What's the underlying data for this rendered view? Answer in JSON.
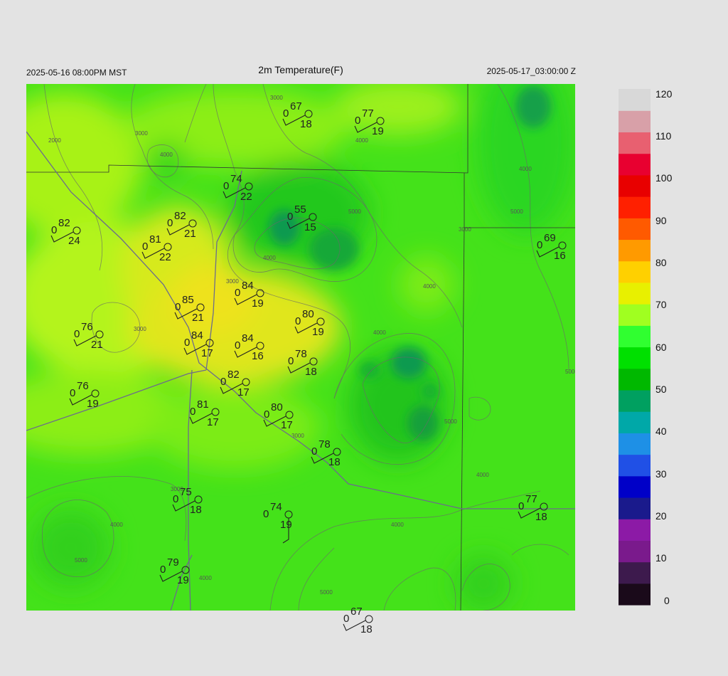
{
  "header": {
    "local_time": "2025-05-16 08:00PM MST",
    "title": "2m Temperature(F)",
    "utc_time": "2025-05-17_03:00:00 Z"
  },
  "colorbar": {
    "labels": [
      "120",
      "110",
      "100",
      "90",
      "80",
      "70",
      "60",
      "50",
      "40",
      "30",
      "20",
      "10",
      "0"
    ],
    "colors": [
      "#1a0a1a",
      "#3d1a4d",
      "#7a1a8c",
      "#8c1aa6",
      "#1a1a8c",
      "#0000c8",
      "#2050e6",
      "#1e90e6",
      "#00a8a8",
      "#00a060",
      "#00b800",
      "#00e000",
      "#30ff30",
      "#a0ff20",
      "#e8f000",
      "#ffd000",
      "#ff9a00",
      "#ff5a00",
      "#ff2000",
      "#e80000",
      "#e80030",
      "#e86070",
      "#d8a0a8",
      "#d8d8d8"
    ]
  },
  "stations": [
    {
      "temp": "67",
      "dew": "18",
      "cloud": "0"
    },
    {
      "temp": "77",
      "dew": "19",
      "cloud": "0"
    },
    {
      "temp": "74",
      "dew": "22",
      "cloud": "0"
    },
    {
      "temp": "55",
      "dew": "15",
      "cloud": "0"
    },
    {
      "temp": "82",
      "dew": "24",
      "cloud": "0"
    },
    {
      "temp": "82",
      "dew": "21",
      "cloud": "0"
    },
    {
      "temp": "81",
      "dew": "22",
      "cloud": "0"
    },
    {
      "temp": "69",
      "dew": "16",
      "cloud": "0"
    },
    {
      "temp": "85",
      "dew": "21",
      "cloud": "0"
    },
    {
      "temp": "84",
      "dew": "19",
      "cloud": "0"
    },
    {
      "temp": "80",
      "dew": "19",
      "cloud": "0"
    },
    {
      "temp": "76",
      "dew": "21",
      "cloud": "0"
    },
    {
      "temp": "84",
      "dew": "17",
      "cloud": "0"
    },
    {
      "temp": "84",
      "dew": "16",
      "cloud": "0"
    },
    {
      "temp": "78",
      "dew": "18",
      "cloud": "0"
    },
    {
      "temp": "82",
      "dew": "17",
      "cloud": "0"
    },
    {
      "temp": "76",
      "dew": "19",
      "cloud": "0"
    },
    {
      "temp": "81",
      "dew": "17",
      "cloud": "0"
    },
    {
      "temp": "80",
      "dew": "17",
      "cloud": "0"
    },
    {
      "temp": "78",
      "dew": "18",
      "cloud": "0"
    },
    {
      "temp": "75",
      "dew": "18",
      "cloud": "0"
    },
    {
      "temp": "74",
      "dew": "19",
      "cloud": "0"
    },
    {
      "temp": "77",
      "dew": "18",
      "cloud": "0"
    },
    {
      "temp": "79",
      "dew": "19",
      "cloud": "0"
    },
    {
      "temp": "67",
      "dew": "18",
      "cloud": "0"
    }
  ],
  "contour_labels": [
    "2000",
    "3000",
    "4000",
    "3000",
    "4000",
    "5000",
    "3000",
    "4000",
    "4000",
    "5000",
    "4000",
    "3000",
    "3000",
    "4000",
    "5000",
    "5000",
    "3000",
    "4000",
    "4000",
    "4000",
    "3000",
    "4000",
    "5000",
    "5000"
  ]
}
